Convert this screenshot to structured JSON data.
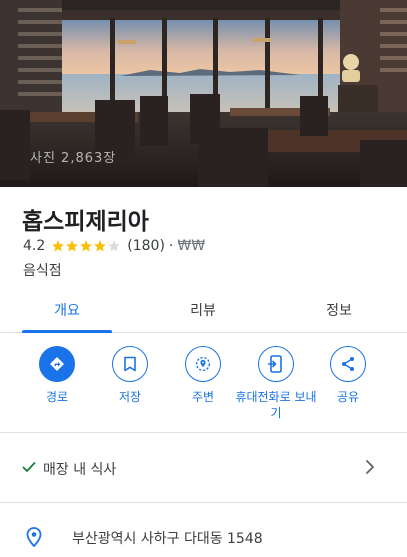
{
  "hero": {
    "photo_credit": "사진 2,863장"
  },
  "place": {
    "name": "홉스피제리아",
    "rating": "4.2",
    "stars": 4.2,
    "review_count": "(180)",
    "separator": "·",
    "price": "₩₩",
    "category": "음식점"
  },
  "tabs": [
    {
      "label": "개요",
      "active": true
    },
    {
      "label": "리뷰",
      "active": false
    },
    {
      "label": "정보",
      "active": false
    }
  ],
  "actions": [
    {
      "label": "경로",
      "icon": "directions-icon"
    },
    {
      "label": "저장",
      "icon": "bookmark-icon"
    },
    {
      "label": "주변",
      "icon": "nearby-icon"
    },
    {
      "label": "휴대전화로 보내기",
      "icon": "send-to-phone-icon"
    },
    {
      "label": "공유",
      "icon": "share-icon"
    }
  ],
  "service": {
    "dine_in": "매장 내 식사"
  },
  "address": "부산광역시 사하구 다대동 1548",
  "colors": {
    "accent": "#1a73e8",
    "star": "#fbbc04",
    "divider": "#e0e0e0"
  }
}
